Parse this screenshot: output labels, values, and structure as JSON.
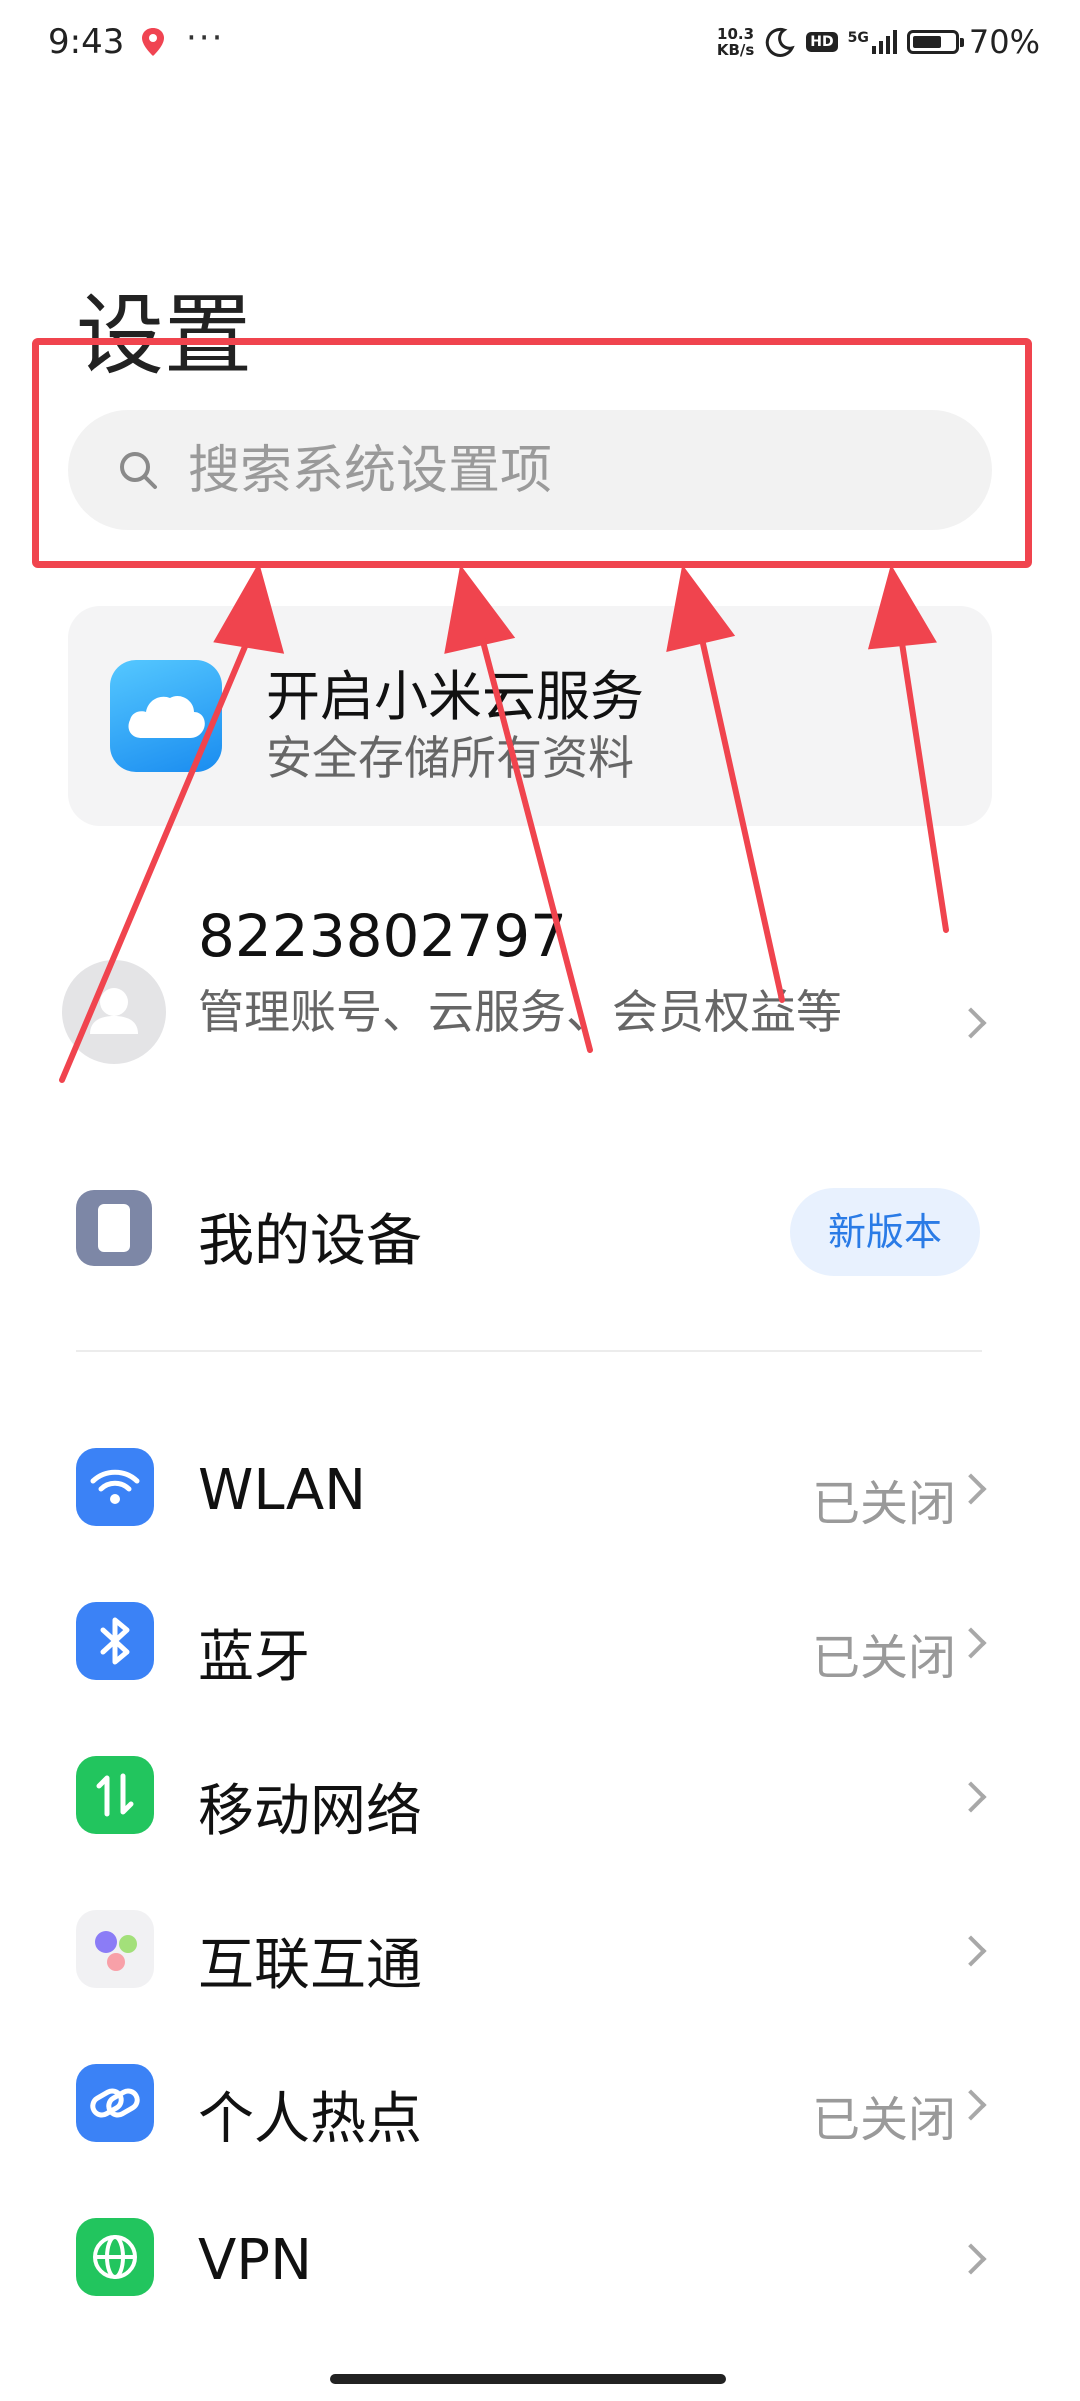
{
  "status_bar": {
    "time": "9:43",
    "more": "···",
    "net_speed_value": "10.3",
    "net_speed_unit": "KB/s",
    "hd": "HD",
    "network": "5G",
    "battery_level": 0.7,
    "battery": "70%"
  },
  "page": {
    "title": "设置"
  },
  "search": {
    "placeholder": "搜索系统设置项"
  },
  "cloud_card": {
    "title": "开启小米云服务",
    "subtitle": "安全存储所有资料"
  },
  "account": {
    "name": "8223802797",
    "description": "管理账号、云服务、会员权益等"
  },
  "device": {
    "label": "我的设备",
    "badge": "新版本"
  },
  "settings": [
    {
      "label": "WLAN",
      "status": "已关闭",
      "icon": "wifi-icon"
    },
    {
      "label": "蓝牙",
      "status": "已关闭",
      "icon": "bluetooth-icon"
    },
    {
      "label": "移动网络",
      "status": "",
      "icon": "mobile-network-icon"
    },
    {
      "label": "互联互通",
      "status": "",
      "icon": "interconnect-icon"
    },
    {
      "label": "个人热点",
      "status": "已关闭",
      "icon": "hotspot-icon"
    },
    {
      "label": "VPN",
      "status": "",
      "icon": "vpn-icon"
    }
  ],
  "annotation": {
    "color": "#f0444e"
  }
}
